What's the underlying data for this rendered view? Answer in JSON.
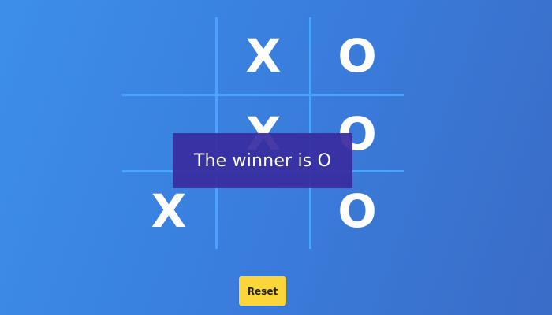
{
  "board": {
    "cells": [
      "",
      "X",
      "O",
      "",
      "X",
      "O",
      "X",
      "",
      "O"
    ]
  },
  "status": {
    "message": "The winner is O"
  },
  "controls": {
    "reset_label": "Reset"
  },
  "colors": {
    "background_start": "#3c8fe8",
    "background_end": "#3a6cc8",
    "grid_line": "#4aa3ff",
    "mark": "#ffffff",
    "banner": "#382ca0",
    "reset_button": "#fbd63b"
  }
}
